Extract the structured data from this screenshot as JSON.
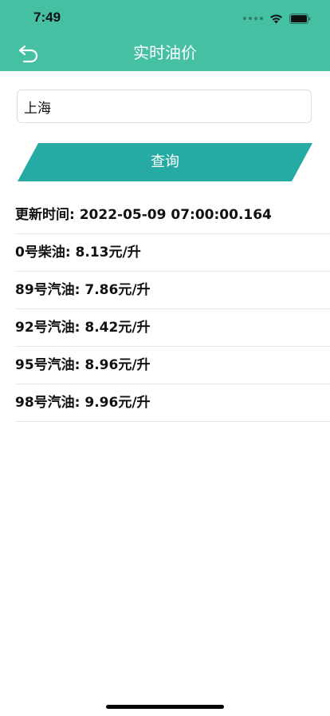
{
  "status_bar": {
    "time": "7:49"
  },
  "nav": {
    "back_icon": "back-arrow-icon",
    "title": "实时油价"
  },
  "search": {
    "value": "上海",
    "placeholder": ""
  },
  "query_button": {
    "label": "查询"
  },
  "prices": {
    "update_time": "更新时间: 2022-05-09 07:00:00.164",
    "rows": [
      {
        "text": "0号柴油: 8.13元/升"
      },
      {
        "text": "89号汽油: 7.86元/升"
      },
      {
        "text": "92号汽油: 8.42元/升"
      },
      {
        "text": "95号汽油: 8.96元/升"
      },
      {
        "text": "98号汽油: 9.96元/升"
      }
    ]
  },
  "colors": {
    "header": "#46c0a2",
    "button": "#26aaa4"
  }
}
